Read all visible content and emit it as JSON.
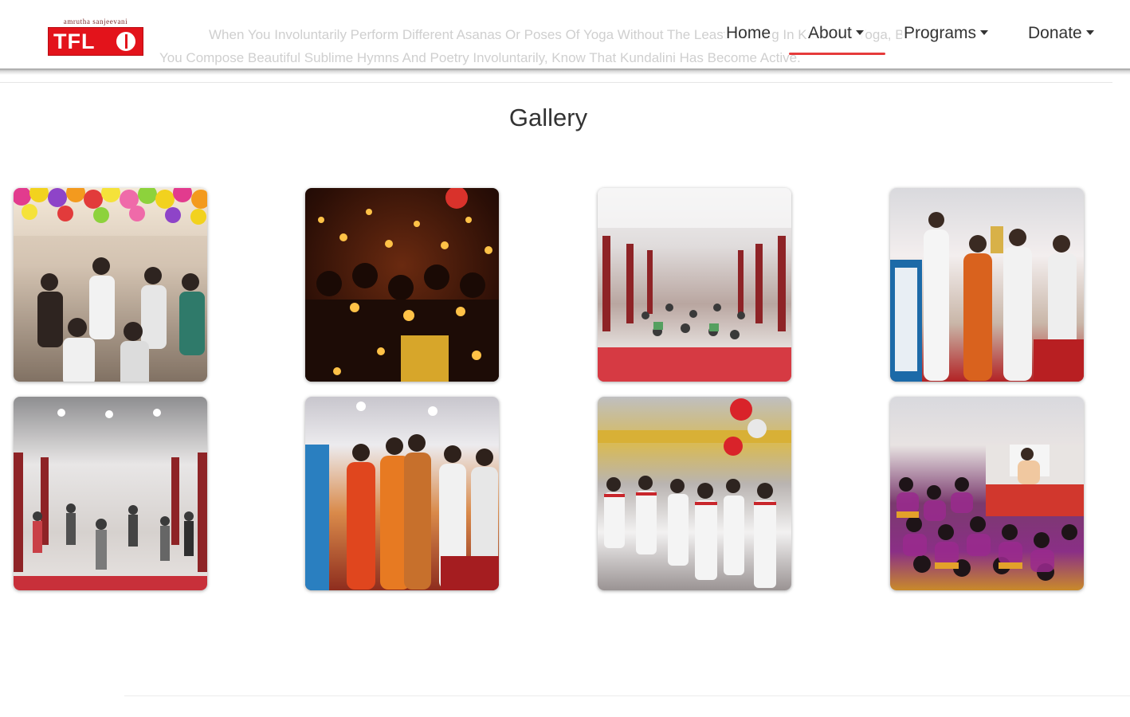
{
  "header": {
    "logo": {
      "tagline": "amrutha sanjeevani",
      "brand": "TFL"
    },
    "marquee": {
      "line1": "When You Involuntarily Perform Different Asanas Or Poses Of Yoga Without The Least Training In Kundalini Yoga, Because",
      "line2": "You Compose Beautiful Sublime Hymns And Poetry Involuntarily, Know That Kundalini Has Become Active."
    },
    "nav": [
      {
        "label": "Home",
        "dropdown": false
      },
      {
        "label": "About",
        "dropdown": true,
        "active": true
      },
      {
        "label": "Programs",
        "dropdown": true
      },
      {
        "label": "Donate",
        "dropdown": true
      }
    ],
    "active_color": "#e63b3b"
  },
  "gallery": {
    "title": "Gallery",
    "photos": [
      {
        "subject": "celebration with balloons"
      },
      {
        "subject": "candle light gathering"
      },
      {
        "subject": "yoga session in hall"
      },
      {
        "subject": "award presentation"
      },
      {
        "subject": "group exercise in hall"
      },
      {
        "subject": "felicitation ceremony"
      },
      {
        "subject": "group standing in decorated hall"
      },
      {
        "subject": "seated group session"
      }
    ]
  },
  "colors": {
    "brand_red": "#e3131b"
  }
}
